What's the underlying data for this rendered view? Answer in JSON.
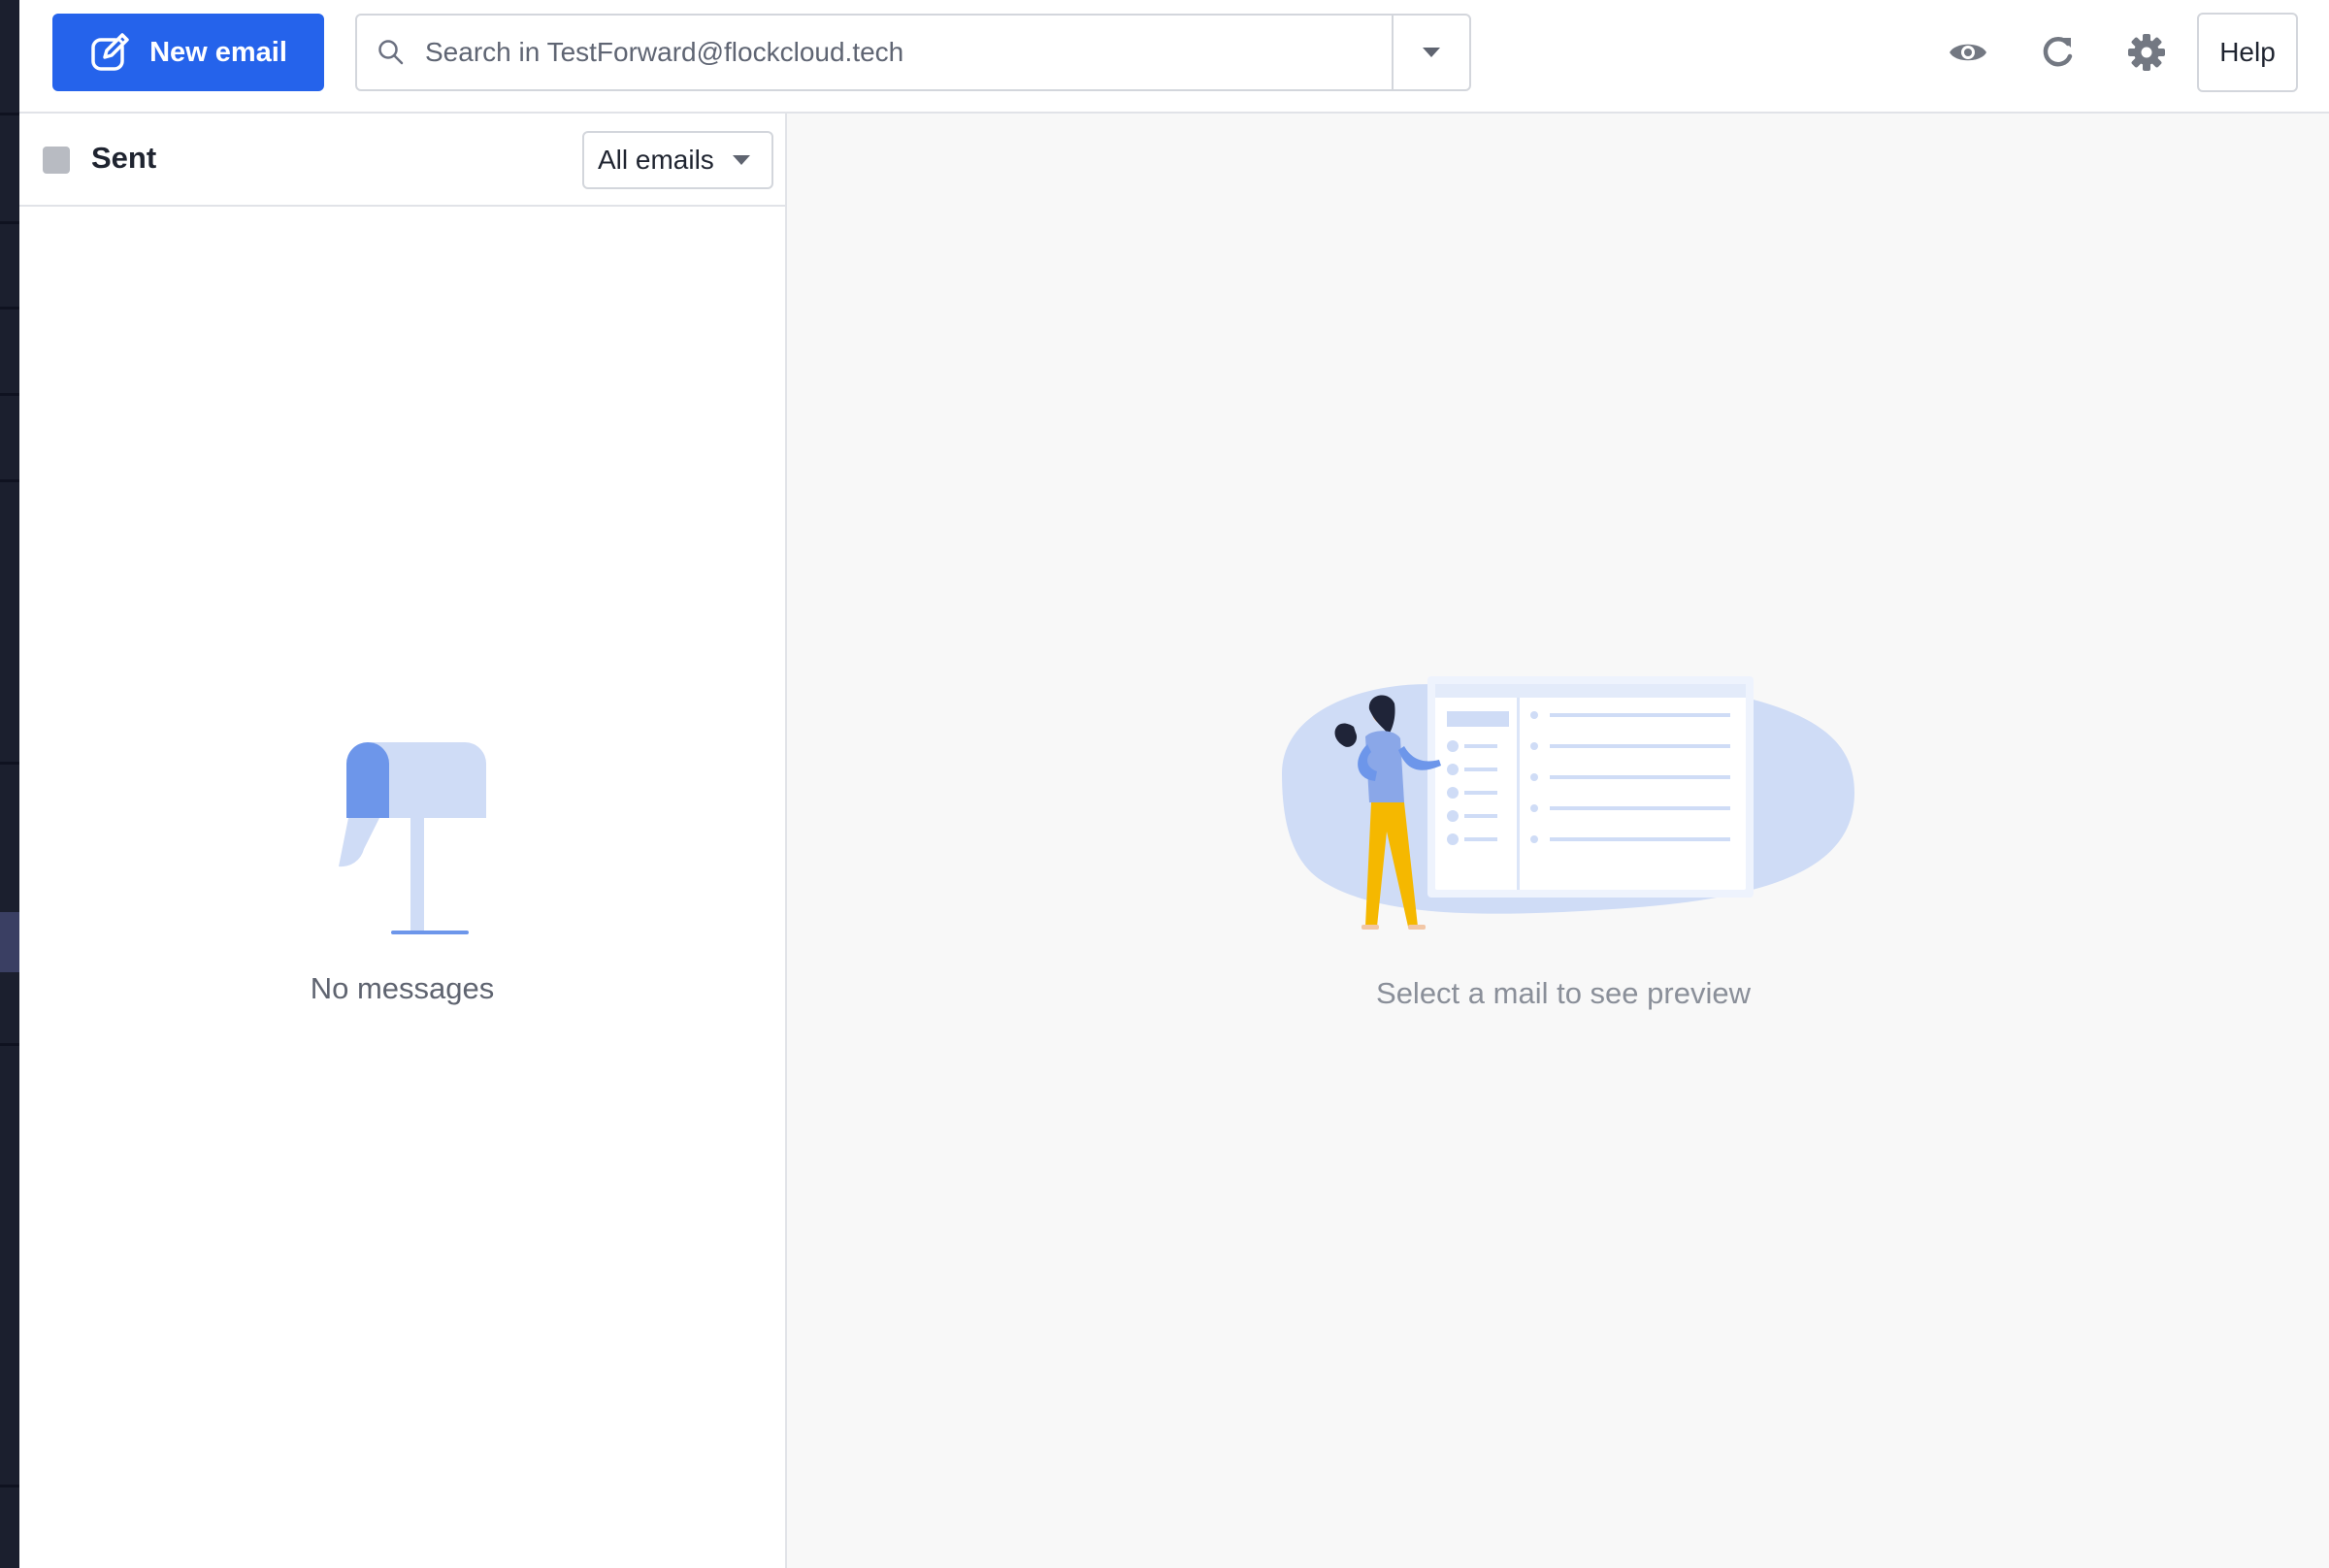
{
  "toolbar": {
    "new_email_label": "New email",
    "search_placeholder": "Search in TestForward@flockcloud.tech",
    "help_label": "Help"
  },
  "icons": {
    "compose": "compose-icon",
    "search": "search-icon",
    "search_dropdown": "caret-down-icon",
    "preview_toggle": "eye-icon",
    "refresh": "refresh-icon",
    "settings": "gear-icon"
  },
  "list": {
    "folder_title": "Sent",
    "filter_value": "All emails",
    "empty_message": "No messages"
  },
  "preview": {
    "empty_message": "Select a mail to see preview"
  },
  "colors": {
    "accent": "#2563eb",
    "illustration_light": "#cfdcf6",
    "illustration_mid": "#6d96ea",
    "figure_yellow": "#f5b800"
  }
}
